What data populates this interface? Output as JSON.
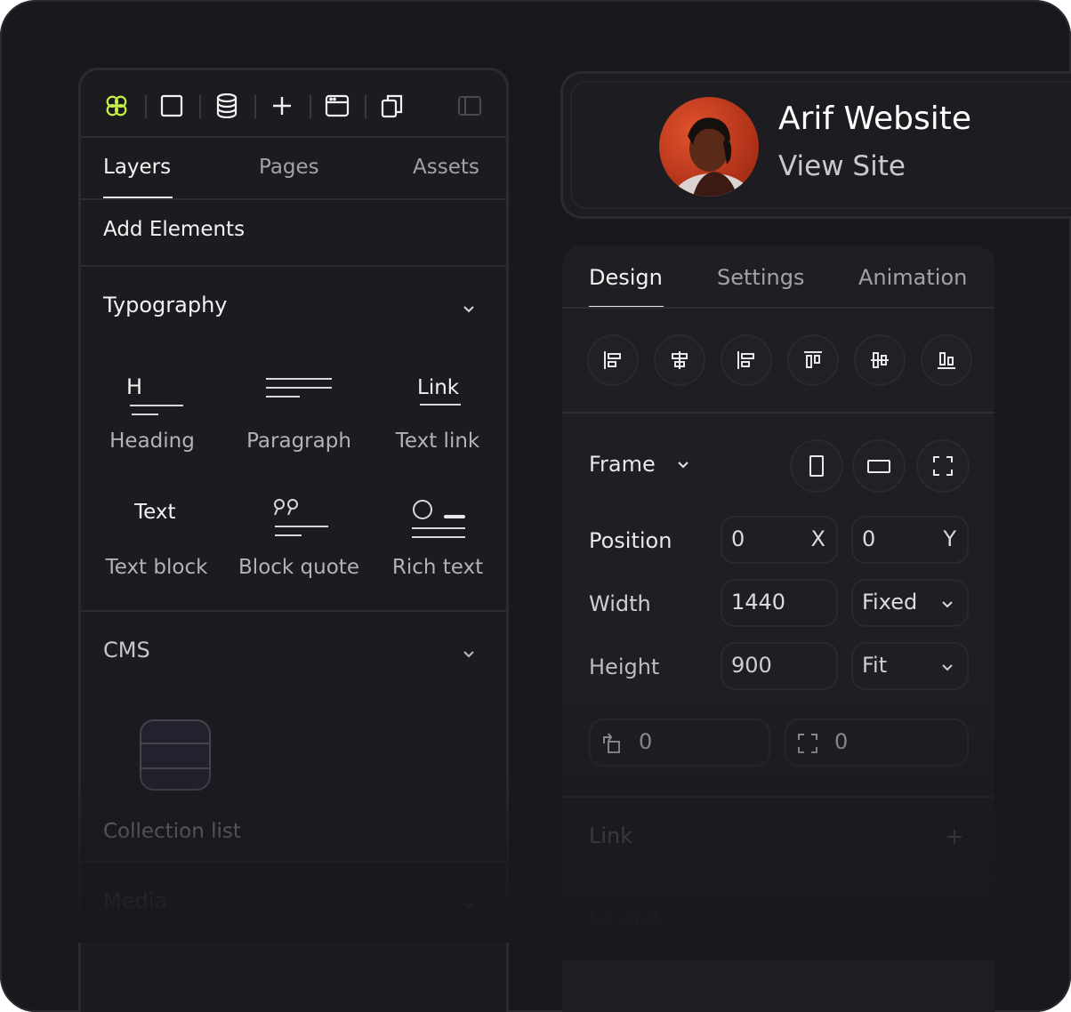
{
  "left_panel": {
    "toolbar": {
      "icons": [
        "logo-icon",
        "frame-square-icon",
        "database-icon",
        "plus-icon",
        "browser-window-icon",
        "copy-icon",
        "sidebar-toggle-icon"
      ],
      "accent": "#c5f046"
    },
    "tabs": [
      {
        "label": "Layers",
        "active": true
      },
      {
        "label": "Pages",
        "active": false
      },
      {
        "label": "Assets",
        "active": false
      }
    ],
    "add_elements": "Add Elements",
    "typography": {
      "title": "Typography",
      "items": [
        {
          "glyph_text": "H",
          "label": "Heading",
          "icon": "heading-icon"
        },
        {
          "glyph_text": "",
          "label": "Paragraph",
          "icon": "paragraph-icon"
        },
        {
          "glyph_text": "Link",
          "label": "Text link",
          "icon": "link-icon"
        },
        {
          "glyph_text": "Text",
          "label": "Text block",
          "icon": "text-block-icon"
        },
        {
          "glyph_text": "",
          "label": "Block quote",
          "icon": "quote-icon"
        },
        {
          "glyph_text": "",
          "label": "Rich text",
          "icon": "rich-text-icon"
        }
      ]
    },
    "cms": {
      "title": "CMS",
      "items": [
        {
          "label": "Collection list",
          "icon": "collection-list-icon"
        }
      ]
    },
    "media": {
      "title": "Media"
    }
  },
  "site_card": {
    "title": "Arif Website",
    "link": "View Site",
    "avatar_icon": "avatar-photo"
  },
  "right_panel": {
    "tabs": [
      {
        "label": "Design",
        "active": true
      },
      {
        "label": "Settings",
        "active": false
      },
      {
        "label": "Animation",
        "active": false
      }
    ],
    "align_icons": [
      "align-left-icon",
      "align-center-h-icon",
      "align-right-icon",
      "align-top-icon",
      "align-center-v-icon",
      "align-bottom-icon"
    ],
    "frame": {
      "label": "Frame",
      "buttons": [
        "portrait-icon",
        "landscape-icon",
        "fullscreen-icon"
      ]
    },
    "position": {
      "label": "Position",
      "x": "0",
      "x_suffix": "X",
      "y": "0",
      "y_suffix": "Y"
    },
    "width": {
      "label": "Width",
      "value": "1440",
      "mode": "Fixed"
    },
    "height": {
      "label": "Height",
      "value": "900",
      "mode": "Fit"
    },
    "rotation": {
      "value": "0",
      "icon": "rotate-icon"
    },
    "radius": {
      "value": "0",
      "icon": "corner-icon"
    },
    "link": {
      "label": "Link"
    },
    "layout": {
      "label": "Layout"
    }
  }
}
